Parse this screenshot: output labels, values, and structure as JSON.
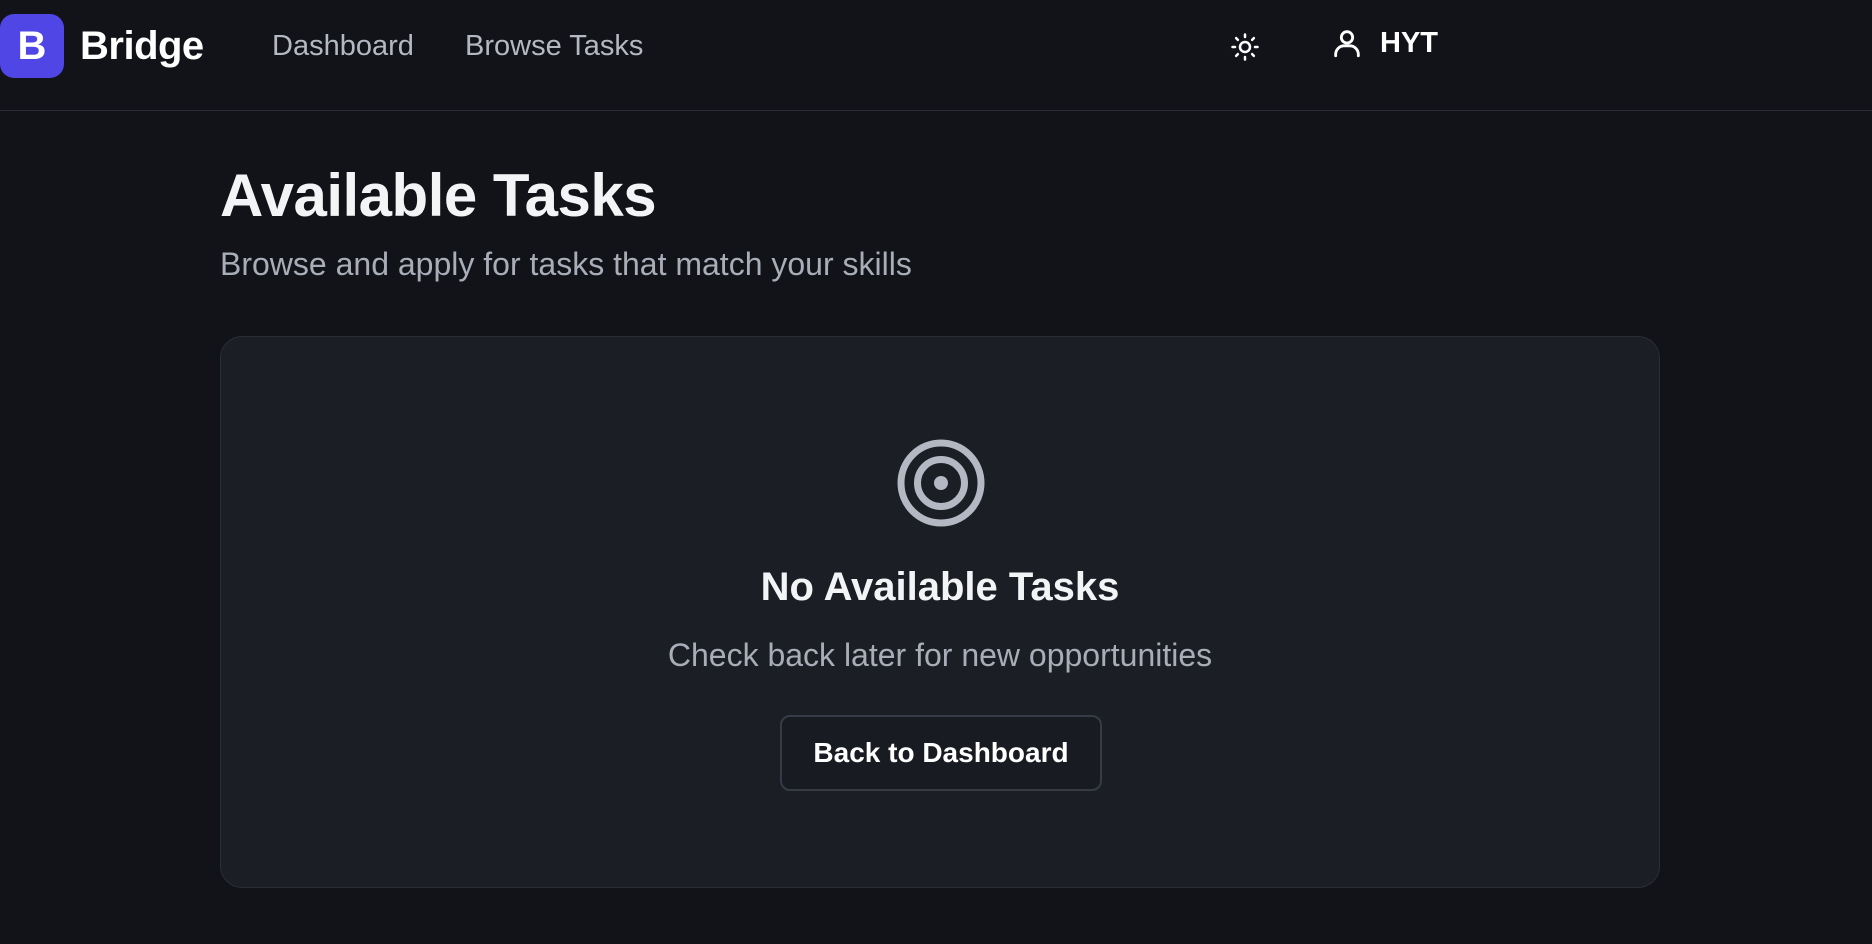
{
  "header": {
    "logo_letter": "B",
    "brand_name": "Bridge",
    "nav": {
      "dashboard": "Dashboard",
      "browse_tasks": "Browse Tasks"
    },
    "theme_icon": "sun-icon",
    "user": {
      "icon": "user-icon",
      "name": "HYT"
    }
  },
  "main": {
    "title": "Available Tasks",
    "subtitle": "Browse and apply for tasks that match your skills",
    "empty_state": {
      "icon": "target-icon",
      "title": "No Available Tasks",
      "message": "Check back later for new opportunities",
      "button_label": "Back to Dashboard"
    }
  },
  "colors": {
    "background": "#111318",
    "card": "#1b1e25",
    "brand_accent": "#4f46e5",
    "muted_text": "#a8adb8"
  }
}
